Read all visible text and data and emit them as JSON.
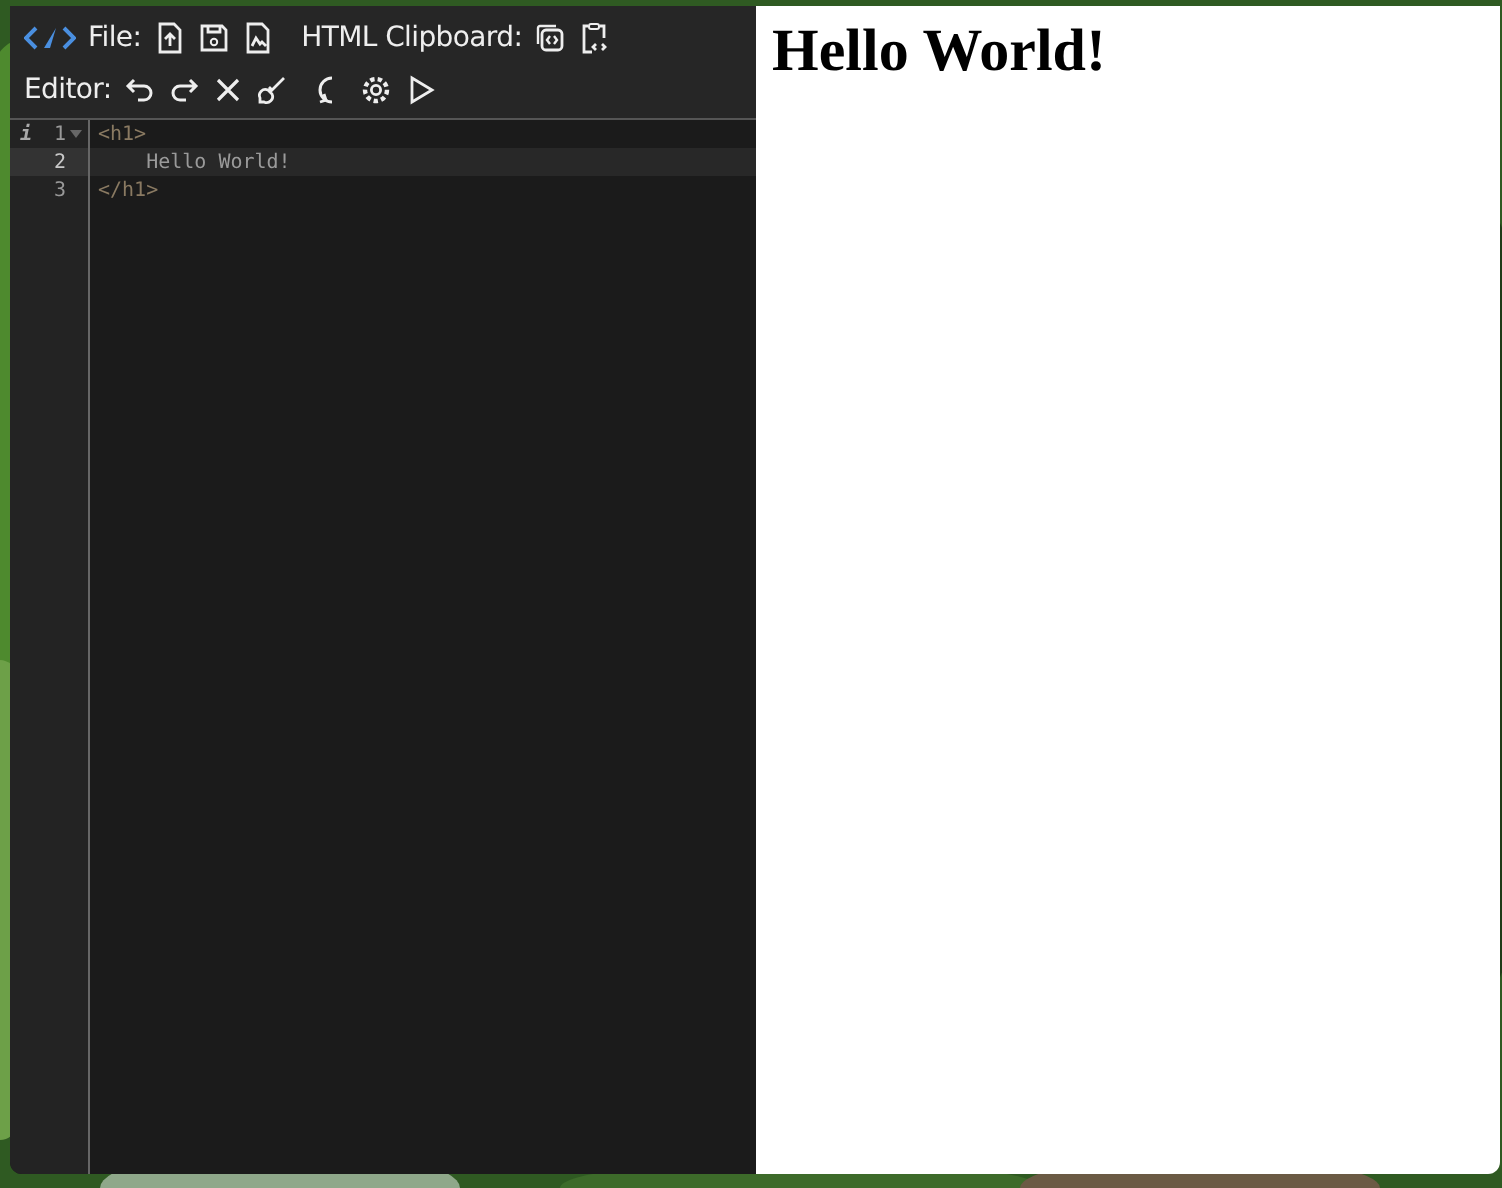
{
  "toolbar": {
    "file_label": "File:",
    "clipboard_label": "HTML Clipboard:",
    "editor_label": "Editor:"
  },
  "editor": {
    "lines": [
      {
        "number": "1",
        "active": false,
        "marker": "i",
        "foldable": true,
        "tokens": [
          {
            "kind": "tag",
            "text": "<h1>"
          }
        ]
      },
      {
        "number": "2",
        "active": true,
        "foldable": false,
        "tokens": [
          {
            "kind": "text",
            "text": "    Hello World!"
          }
        ]
      },
      {
        "number": "3",
        "active": false,
        "foldable": false,
        "tokens": [
          {
            "kind": "tag",
            "text": "</h1>"
          }
        ]
      }
    ]
  },
  "preview": {
    "heading": "Hello World!"
  }
}
